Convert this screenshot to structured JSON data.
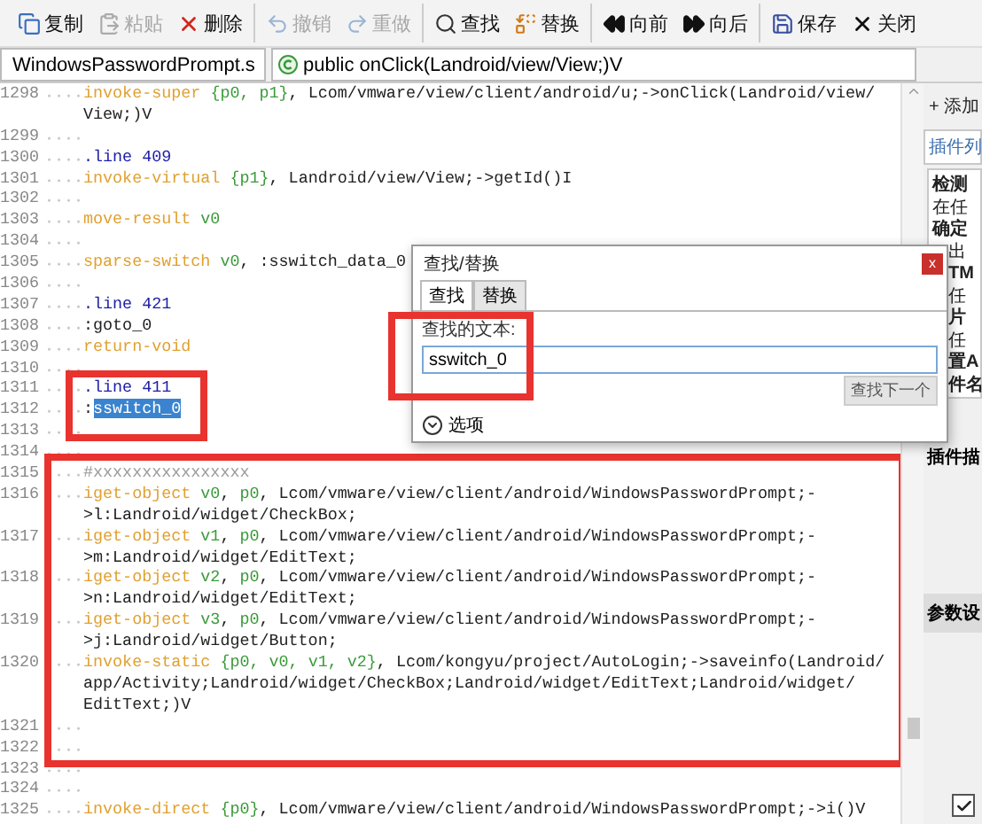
{
  "toolbar": {
    "groups": [
      [
        {
          "kind": "copy",
          "label": "复制",
          "disabled": false
        },
        {
          "kind": "paste",
          "label": "粘贴",
          "disabled": true
        },
        {
          "kind": "delete",
          "label": "删除",
          "disabled": false
        }
      ],
      [
        {
          "kind": "undo",
          "label": "撤销",
          "disabled": true
        },
        {
          "kind": "redo",
          "label": "重做",
          "disabled": true
        }
      ],
      [
        {
          "kind": "search",
          "label": "查找",
          "disabled": false
        },
        {
          "kind": "replace",
          "label": "替换",
          "disabled": false
        }
      ],
      [
        {
          "kind": "back",
          "label": "向前",
          "disabled": false
        },
        {
          "kind": "forward",
          "label": "向后",
          "disabled": false
        }
      ],
      [
        {
          "kind": "save",
          "label": "保存",
          "disabled": false
        },
        {
          "kind": "close",
          "label": "关闭",
          "disabled": false
        }
      ]
    ]
  },
  "file_select": {
    "value": "WindowsPasswordPrompt.s"
  },
  "method_select": {
    "value": "public onClick(Landroid/view/View;)V"
  },
  "editor": {
    "sections": [
      {
        "kind": "plain",
        "lines": [
          {
            "number": "1298",
            "rows": [
              [
                {
                  "kind": "op",
                  "text": "invoke-super"
                },
                {
                  "kind": "plain",
                  "text": " "
                },
                {
                  "kind": "reg",
                  "text": "{p0, p1}"
                },
                {
                  "kind": "plain",
                  "text": ", Lcom/vmware/view/client/android/u;->onClick(Landroid/view/"
                }
              ],
              [
                {
                  "kind": "plain",
                  "text": "View;)V"
                }
              ]
            ]
          },
          {
            "number": "1299"
          },
          {
            "number": "1300",
            "rows": [
              [
                {
                  "kind": "dir",
                  "text": ".line"
                },
                {
                  "kind": "plain",
                  "text": " "
                },
                {
                  "kind": "num",
                  "text": "409"
                }
              ]
            ]
          },
          {
            "number": "1301",
            "rows": [
              [
                {
                  "kind": "op",
                  "text": "invoke-virtual"
                },
                {
                  "kind": "plain",
                  "text": " "
                },
                {
                  "kind": "reg",
                  "text": "{p1}"
                },
                {
                  "kind": "plain",
                  "text": ", Landroid/view/View;->getId()I"
                }
              ]
            ]
          },
          {
            "number": "1302"
          },
          {
            "number": "1303",
            "rows": [
              [
                {
                  "kind": "op",
                  "text": "move-result"
                },
                {
                  "kind": "plain",
                  "text": " "
                },
                {
                  "kind": "reg",
                  "text": "v0"
                }
              ]
            ]
          },
          {
            "number": "1304"
          },
          {
            "number": "1305",
            "rows": [
              [
                {
                  "kind": "op",
                  "text": "sparse-switch"
                },
                {
                  "kind": "plain",
                  "text": " "
                },
                {
                  "kind": "reg",
                  "text": "v0"
                },
                {
                  "kind": "plain",
                  "text": ", :sswitch_data_0"
                }
              ]
            ]
          },
          {
            "number": "1306"
          },
          {
            "number": "1307",
            "rows": [
              [
                {
                  "kind": "dir",
                  "text": ".line"
                },
                {
                  "kind": "plain",
                  "text": " "
                },
                {
                  "kind": "num",
                  "text": "421"
                }
              ]
            ]
          },
          {
            "number": "1308",
            "rows": [
              [
                {
                  "kind": "plain",
                  "text": ":goto_0"
                }
              ]
            ]
          },
          {
            "number": "1309",
            "rows": [
              [
                {
                  "kind": "op",
                  "text": "return-void"
                }
              ]
            ]
          },
          {
            "number": "1310"
          }
        ]
      },
      {
        "kind": "tight",
        "lines": [
          {
            "number": "1311",
            "rows": [
              [
                {
                  "kind": "dir",
                  "text": ".line"
                },
                {
                  "kind": "plain",
                  "text": " "
                },
                {
                  "kind": "num",
                  "text": "411"
                }
              ]
            ]
          },
          {
            "number": "1312",
            "rows": [
              [
                {
                  "kind": "plain",
                  "text": ":"
                },
                {
                  "kind": "selected",
                  "text": "sswitch_0"
                }
              ]
            ]
          },
          {
            "number": "1313"
          }
        ]
      },
      {
        "kind": "plain",
        "lines": [
          {
            "number": "1314"
          }
        ]
      },
      {
        "kind": "wide",
        "lines": [
          {
            "number": "1315",
            "rows": [
              [
                {
                  "kind": "comment",
                  "text": "#xxxxxxxxxxxxxxxx"
                }
              ]
            ]
          },
          {
            "number": "1316",
            "rows": [
              [
                {
                  "kind": "op",
                  "text": "iget-object"
                },
                {
                  "kind": "plain",
                  "text": " "
                },
                {
                  "kind": "reg",
                  "text": "v0"
                },
                {
                  "kind": "plain",
                  "text": ", "
                },
                {
                  "kind": "reg",
                  "text": "p0"
                },
                {
                  "kind": "plain",
                  "text": ", Lcom/vmware/view/client/android/WindowsPasswordPrompt;-"
                }
              ],
              [
                {
                  "kind": "plain",
                  "text": ">l:Landroid/widget/CheckBox;"
                }
              ]
            ]
          },
          {
            "number": "1317",
            "rows": [
              [
                {
                  "kind": "op",
                  "text": "iget-object"
                },
                {
                  "kind": "plain",
                  "text": " "
                },
                {
                  "kind": "reg",
                  "text": "v1"
                },
                {
                  "kind": "plain",
                  "text": ", "
                },
                {
                  "kind": "reg",
                  "text": "p0"
                },
                {
                  "kind": "plain",
                  "text": ", Lcom/vmware/view/client/android/WindowsPasswordPrompt;-"
                }
              ],
              [
                {
                  "kind": "plain",
                  "text": ">m:Landroid/widget/EditText;"
                }
              ]
            ]
          },
          {
            "number": "1318",
            "rows": [
              [
                {
                  "kind": "op",
                  "text": "iget-object"
                },
                {
                  "kind": "plain",
                  "text": " "
                },
                {
                  "kind": "reg",
                  "text": "v2"
                },
                {
                  "kind": "plain",
                  "text": ", "
                },
                {
                  "kind": "reg",
                  "text": "p0"
                },
                {
                  "kind": "plain",
                  "text": ", Lcom/vmware/view/client/android/WindowsPasswordPrompt;-"
                }
              ],
              [
                {
                  "kind": "plain",
                  "text": ">n:Landroid/widget/EditText;"
                }
              ]
            ]
          },
          {
            "number": "1319",
            "rows": [
              [
                {
                  "kind": "op",
                  "text": "iget-object"
                },
                {
                  "kind": "plain",
                  "text": " "
                },
                {
                  "kind": "reg",
                  "text": "v3"
                },
                {
                  "kind": "plain",
                  "text": ", "
                },
                {
                  "kind": "reg",
                  "text": "p0"
                },
                {
                  "kind": "plain",
                  "text": ", Lcom/vmware/view/client/android/WindowsPasswordPrompt;-"
                }
              ],
              [
                {
                  "kind": "plain",
                  "text": ">j:Landroid/widget/Button;"
                }
              ]
            ]
          },
          {
            "number": "1320",
            "rows": [
              [
                {
                  "kind": "op",
                  "text": "invoke-static"
                },
                {
                  "kind": "plain",
                  "text": " "
                },
                {
                  "kind": "reg",
                  "text": "{p0, v0, v1, v2}"
                },
                {
                  "kind": "plain",
                  "text": ", Lcom/kongyu/project/AutoLogin;->saveinfo(Landroid/"
                }
              ],
              [
                {
                  "kind": "plain",
                  "text": "app/Activity;Landroid/widget/CheckBox;Landroid/widget/EditText;Landroid/widget/"
                }
              ],
              [
                {
                  "kind": "plain",
                  "text": "EditText;)V"
                }
              ]
            ]
          },
          {
            "number": "1321"
          },
          {
            "number": "1322"
          }
        ]
      },
      {
        "kind": "plain",
        "lines": [
          {
            "number": "1323"
          },
          {
            "number": "1324"
          },
          {
            "number": "1325",
            "rows": [
              [
                {
                  "kind": "op",
                  "text": "invoke-direct"
                },
                {
                  "kind": "plain",
                  "text": " "
                },
                {
                  "kind": "reg",
                  "text": "{p0}"
                },
                {
                  "kind": "plain",
                  "text": ", Lcom/vmware/view/client/android/WindowsPasswordPrompt;->i()V"
                }
              ]
            ]
          }
        ]
      }
    ]
  },
  "side_panel": {
    "add_link": "+ 添加",
    "tab": "插件列",
    "items": [
      {
        "kind": "title",
        "text": "检测",
        "covered": false
      },
      {
        "kind": "desc",
        "text": "在任",
        "covered": false
      },
      {
        "kind": "title",
        "text": "确定",
        "covered": false
      },
      {
        "kind": "desc",
        "text": "出",
        "covered": true
      },
      {
        "kind": "title",
        "text": "TM",
        "covered": true
      },
      {
        "kind": "desc",
        "text": "任",
        "covered": true
      },
      {
        "kind": "title",
        "text": "片",
        "covered": true
      },
      {
        "kind": "desc",
        "text": "任",
        "covered": true
      },
      {
        "kind": "title",
        "text": "置A",
        "covered": true
      },
      {
        "kind": "title",
        "text": "件名",
        "covered": true
      }
    ],
    "section": "插件描",
    "settings": "参数设",
    "checkbox": {
      "checked": true
    }
  },
  "find_dialog": {
    "title": "查找/替换",
    "close": "x",
    "tabs": [
      {
        "label": "查找",
        "selected": true
      },
      {
        "label": "替换",
        "selected": false
      }
    ],
    "field_label": "查找的文本:",
    "field_value": "sswitch_0",
    "field_framed": true,
    "next_button": "查找下一个",
    "options": "选项"
  }
}
